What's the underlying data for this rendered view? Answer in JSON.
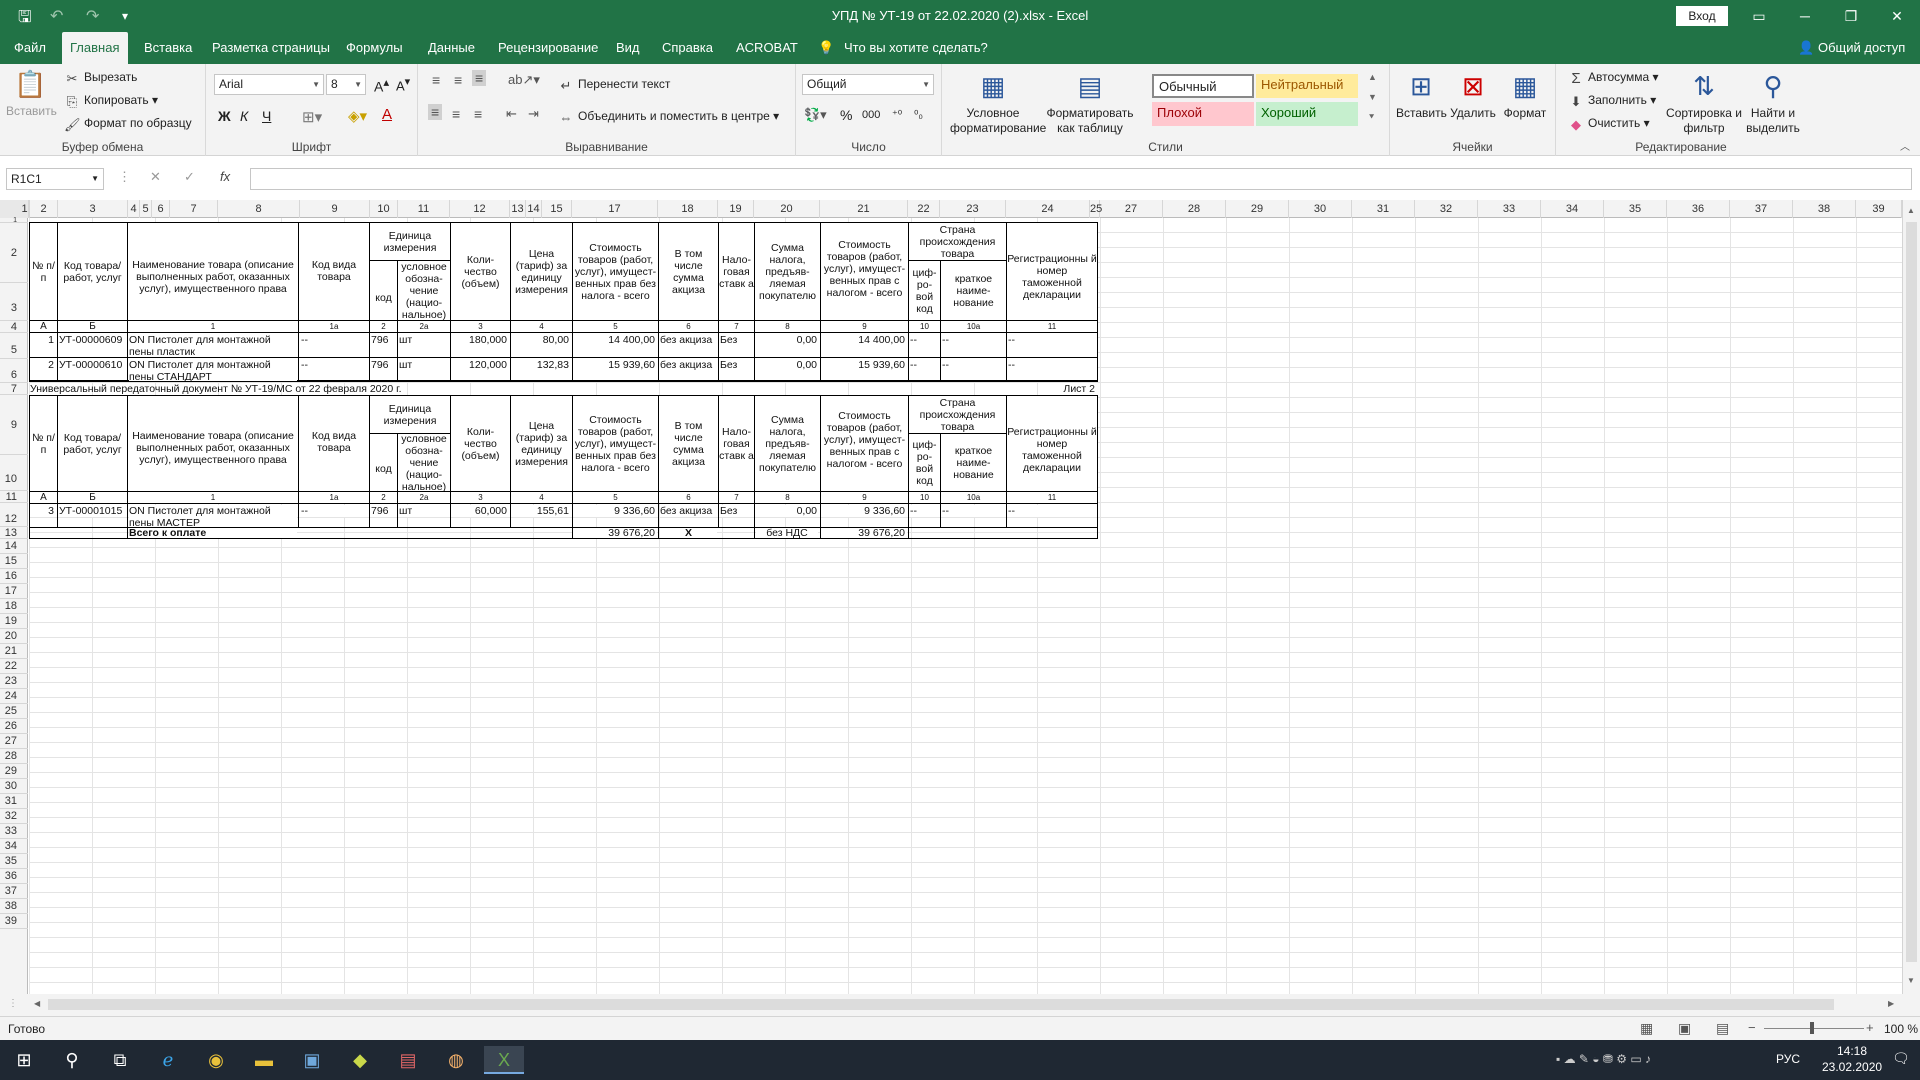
{
  "window": {
    "title": "УПД № УТ-19 от 22.02.2020 (2).xlsx  -  Excel",
    "signin": "Вход",
    "share": "Общий доступ"
  },
  "tabs": [
    "Файл",
    "Главная",
    "Вставка",
    "Разметка страницы",
    "Формулы",
    "Данные",
    "Рецензирование",
    "Вид",
    "Справка",
    "ACROBAT"
  ],
  "tell_me": "Что вы хотите сделать?",
  "ribbon": {
    "clipboard": {
      "label": "Буфер обмена",
      "paste": "Вставить",
      "cut": "Вырезать",
      "copy": "Копировать",
      "format_painter": "Формат по образцу"
    },
    "font": {
      "label": "Шрифт",
      "name": "Arial",
      "size": "8",
      "bold": "Ж",
      "italic": "К",
      "underline": "Ч"
    },
    "alignment": {
      "label": "Выравнивание",
      "wrap": "Перенести текст",
      "merge": "Объединить и поместить в центре"
    },
    "number": {
      "label": "Число",
      "format": "Общий"
    },
    "styles": {
      "label": "Стили",
      "conditional": "Условное форматирование",
      "as_table": "Форматировать как таблицу",
      "normal": "Обычный",
      "neutral": "Нейтральный",
      "bad": "Плохой",
      "good": "Хороший"
    },
    "cells": {
      "label": "Ячейки",
      "insert": "Вставить",
      "delete": "Удалить",
      "format": "Формат"
    },
    "editing": {
      "label": "Редактирование",
      "autosum": "Автосумма",
      "fill": "Заполнить",
      "clear": "Очистить",
      "sort": "Сортировка и фильтр",
      "find": "Найти и выделить"
    }
  },
  "formula_bar": {
    "name_box": "R1C1",
    "fx": "fx",
    "value": ""
  },
  "columns": [
    "1",
    "2",
    "3",
    "4",
    "5",
    "6",
    "7",
    "8",
    "9",
    "10",
    "11",
    "12",
    "13",
    "14",
    "15",
    "17",
    "18",
    "19",
    "20",
    "21",
    "22",
    "23",
    "24",
    "25",
    "27",
    "28",
    "29",
    "30",
    "31",
    "32",
    "33",
    "34",
    "35",
    "36",
    "37",
    "38",
    "39"
  ],
  "rows": [
    "1",
    "2",
    "3",
    "4",
    "5",
    "6",
    "7",
    "9",
    "10",
    "11",
    "12",
    "13",
    "14",
    "15",
    "16",
    "17",
    "18",
    "19",
    "20",
    "21",
    "22",
    "23",
    "24",
    "25",
    "26",
    "27",
    "28",
    "29",
    "30",
    "31",
    "32",
    "33",
    "34",
    "35",
    "36",
    "37",
    "38",
    "39"
  ],
  "table_header": {
    "num": "№ п/п",
    "code": "Код товара/ работ, услуг",
    "name": "Наименование товара (описание выполненных работ, оказанных услуг), имущественного права",
    "kind_code": "Код вида товара",
    "unit": "Единица измерения",
    "unit_code": "код",
    "unit_sym": "условное обозна-чение (нацио-нальное)",
    "qty": "Коли-чество (объем)",
    "price": "Цена (тариф) за единицу измерения",
    "cost_wo_tax": "Стоимость товаров (работ, услуг), имущест-венных прав без налога - всего",
    "excise": "В том числе сумма акциза",
    "tax_rate": "Нало-говая ставк а",
    "tax_sum": "Сумма налога, предъяв-ляемая покупателю",
    "cost_w_tax": "Стоимость товаров (работ, услуг), имущест-венных прав с налогом - всего",
    "country": "Страна происхождения товара",
    "country_code": "циф-ро-вой код",
    "country_name": "краткое наиме-нование",
    "customs": "Регистрационны й номер таможенной декларации"
  },
  "col_index": [
    "А",
    "Б",
    "1",
    "1а",
    "2",
    "2а",
    "3",
    "4",
    "5",
    "6",
    "7",
    "8",
    "9",
    "10",
    "10а",
    "11"
  ],
  "items_page1": [
    {
      "n": "1",
      "code": "УТ-00000609",
      "name1": "ON Пистолет для монтажной",
      "name2": "пены пластик",
      "kind": "--",
      "unit": "796",
      "sym": "шт",
      "qty": "180,000",
      "price": "80,00",
      "cost": "14 400,00",
      "excise": "без акциза",
      "rate": "Без НДС",
      "tax": "0,00",
      "total": "14 400,00",
      "cc": "--",
      "cn": "--",
      "decl": "--"
    },
    {
      "n": "2",
      "code": "УТ-00000610",
      "name1": "ON Пистолет для монтажной",
      "name2": "пены СТАНДАРТ",
      "kind": "--",
      "unit": "796",
      "sym": "шт",
      "qty": "120,000",
      "price": "132,83",
      "cost": "15 939,60",
      "excise": "без акциза",
      "rate": "Без НДС",
      "tax": "0,00",
      "total": "15 939,60",
      "cc": "--",
      "cn": "--",
      "decl": "--"
    }
  ],
  "page_caption": "Универсальный передаточный документ № УТ-19/МС от 22 февраля 2020 г.",
  "sheet_label": "Лист 2",
  "items_page2": [
    {
      "n": "3",
      "code": "УТ-00001015",
      "name1": "ON Пистолет для монтажной",
      "name2": "пены МАСТЕР",
      "kind": "--",
      "unit": "796",
      "sym": "шт",
      "qty": "60,000",
      "price": "155,61",
      "cost": "9 336,60",
      "excise": "без акциза",
      "rate": "Без НДС",
      "tax": "0,00",
      "total": "9 336,60",
      "cc": "--",
      "cn": "--",
      "decl": "--"
    }
  ],
  "totals": {
    "label": "Всего к оплате",
    "cost": "39 676,20",
    "x": "X",
    "tax": "без НДС",
    "total": "39 676,20"
  },
  "status": {
    "ready": "Готово",
    "zoom": "100 %"
  },
  "taskbar": {
    "lang": "РУС",
    "time": "14:18",
    "date": "23.02.2020"
  }
}
